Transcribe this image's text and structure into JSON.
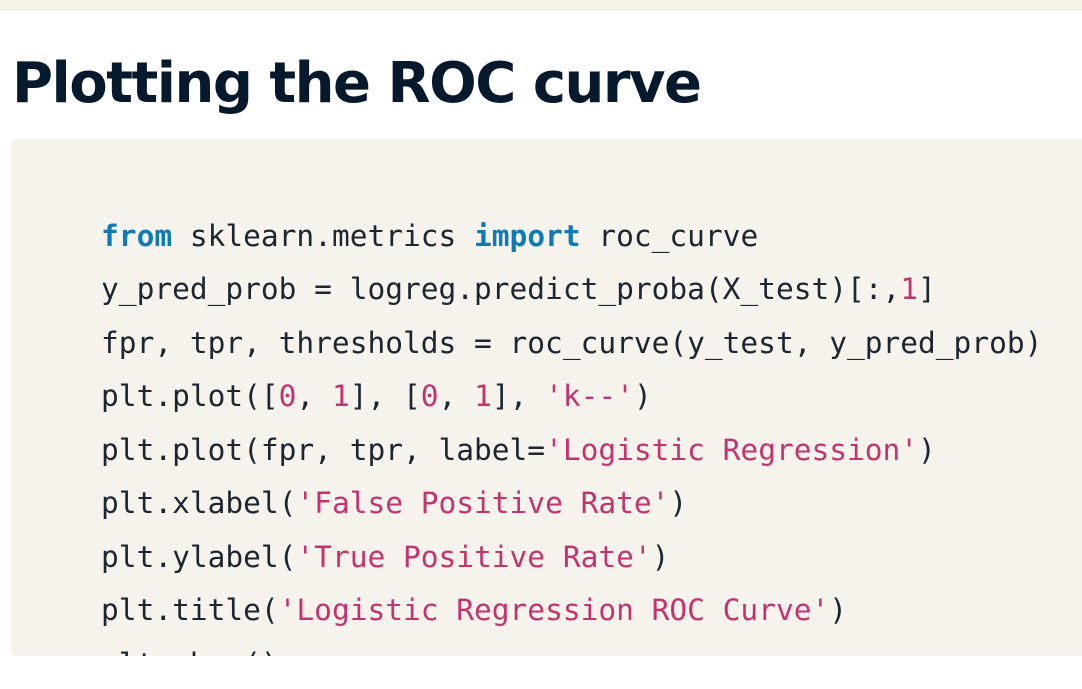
{
  "title": "Plotting the ROC curve",
  "code_lines": [
    [
      {
        "t": "kw",
        "v": "from"
      },
      {
        "t": "plain",
        "v": " sklearn.metrics "
      },
      {
        "t": "kw",
        "v": "import"
      },
      {
        "t": "plain",
        "v": " roc_curve"
      }
    ],
    [
      {
        "t": "plain",
        "v": "y_pred_prob = logreg.predict_proba(X_test)[:,"
      },
      {
        "t": "num",
        "v": "1"
      },
      {
        "t": "plain",
        "v": "]"
      }
    ],
    [
      {
        "t": "plain",
        "v": "fpr, tpr, thresholds = roc_curve(y_test, y_pred_prob)"
      }
    ],
    [
      {
        "t": "plain",
        "v": "plt.plot(["
      },
      {
        "t": "num",
        "v": "0"
      },
      {
        "t": "plain",
        "v": ", "
      },
      {
        "t": "num",
        "v": "1"
      },
      {
        "t": "plain",
        "v": "], ["
      },
      {
        "t": "num",
        "v": "0"
      },
      {
        "t": "plain",
        "v": ", "
      },
      {
        "t": "num",
        "v": "1"
      },
      {
        "t": "plain",
        "v": "], "
      },
      {
        "t": "str",
        "v": "'k--'"
      },
      {
        "t": "plain",
        "v": ")"
      }
    ],
    [
      {
        "t": "plain",
        "v": "plt.plot(fpr, tpr, label="
      },
      {
        "t": "str",
        "v": "'Logistic Regression'"
      },
      {
        "t": "plain",
        "v": ")"
      }
    ],
    [
      {
        "t": "plain",
        "v": "plt.xlabel("
      },
      {
        "t": "str",
        "v": "'False Positive Rate'"
      },
      {
        "t": "plain",
        "v": ")"
      }
    ],
    [
      {
        "t": "plain",
        "v": "plt.ylabel("
      },
      {
        "t": "str",
        "v": "'True Positive Rate'"
      },
      {
        "t": "plain",
        "v": ")"
      }
    ],
    [
      {
        "t": "plain",
        "v": "plt.title("
      },
      {
        "t": "str",
        "v": "'Logistic Regression ROC Curve'"
      },
      {
        "t": "plain",
        "v": ")"
      }
    ],
    [
      {
        "t": "plain",
        "v": "plt.show();"
      }
    ]
  ],
  "colors": {
    "title": "#06192d",
    "keyword": "#0d7cb6",
    "string": "#c3346f",
    "code_text": "#1c2530",
    "code_background": "#f6f2ec"
  }
}
